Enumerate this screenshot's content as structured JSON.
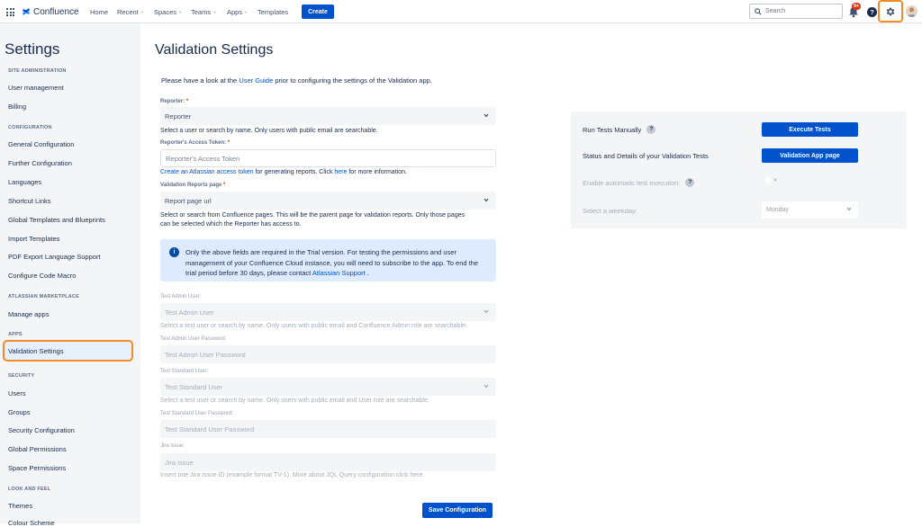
{
  "topbar": {
    "brand": "Confluence",
    "nav": [
      {
        "label": "Home",
        "caret": false
      },
      {
        "label": "Recent",
        "caret": true
      },
      {
        "label": "Spaces",
        "caret": true
      },
      {
        "label": "Teams",
        "caret": true
      },
      {
        "label": "Apps",
        "caret": true
      },
      {
        "label": "Templates",
        "caret": false
      }
    ],
    "create_label": "Create",
    "search_placeholder": "Search",
    "notification_count": "9+"
  },
  "sidebar": {
    "title": "Settings",
    "sections": [
      {
        "heading": "SITE ADMINISTRATION",
        "items": [
          "User management",
          "Billing"
        ]
      },
      {
        "heading": "CONFIGURATION",
        "items": [
          "General Configuration",
          "Further Configuration",
          "Languages",
          "Shortcut Links",
          "Global Templates and Blueprints",
          "Import Templates",
          "PDF Export Language Support",
          "Configure Code Macro"
        ]
      },
      {
        "heading": "ATLASSIAN MARKETPLACE",
        "items": [
          "Manage apps"
        ]
      },
      {
        "heading": "APPS",
        "items": [
          "Validation Settings"
        ]
      },
      {
        "heading": "SECURITY",
        "items": [
          "Users",
          "Groups",
          "Security Configuration",
          "Global Permissions",
          "Space Permissions"
        ]
      },
      {
        "heading": "LOOK AND FEEL",
        "items": [
          "Themes",
          "Colour Scheme"
        ]
      }
    ],
    "active_item": "Validation Settings"
  },
  "main": {
    "title": "Validation Settings",
    "intro_before": "Please have a look at the ",
    "intro_link": "User Guide",
    "intro_after": " prior to configuring the settings of the Validation app.",
    "reporter": {
      "label": "Reporter:",
      "required": "*",
      "value": "Reporter",
      "help": "Select a user or search by name. Only users with public email are searchable."
    },
    "token": {
      "label": "Reporter's Access Token:",
      "required": "*",
      "placeholder": "Reporter's Access Token",
      "help_link": "Create an Atlassian access token",
      "help_mid": " for generating reports. Click ",
      "help_link2": "here",
      "help_end": "  for more information."
    },
    "reports_page": {
      "label": "Validation Reports page",
      "required": "*",
      "value": "Report page url",
      "help_line1": "Select or search from Confluence pages. This will be the parent page for validation reports. Only those pages",
      "help_line2": "can be selected which the Reporter has access to."
    },
    "info": {
      "text_before": "Only the above fields are required in the Trial version. For testing the permissions and user management of your Confluence Cloud instance, you will need to subscribe to the app. To end the trial period before 30 days, please contact ",
      "link": "Atlassian Support",
      "text_after": " ."
    },
    "test_admin_user": {
      "label": "Test Admin User:",
      "placeholder": "Test Admin User",
      "help": "Select a test user or search by name. Only users with public email and Confluence Admin role are searchable."
    },
    "test_admin_password": {
      "label": "Test Admin User Password:",
      "placeholder": "Test Admin User Password"
    },
    "test_standard_user": {
      "label": "Test Standard User:",
      "placeholder": "Test Standard User",
      "help": "Select a test user or search by name. Only users with public email and User role are searchable."
    },
    "test_standard_password": {
      "label": "Test Standard User Password:",
      "placeholder": "Test Standard User Password"
    },
    "jira": {
      "label": "Jira issue:",
      "placeholder": "Jira issue",
      "help": "Insert one Jira issue ID (example format TV-1). More about JQL Query configuration click here."
    },
    "save_label": "Save Configuration"
  },
  "panel": {
    "run_label": "Run Tests Manually",
    "run_button": "Execute Tests",
    "status_label": "Status and Details of your Validation Tests",
    "status_button": "Validation App page",
    "auto_label": "Enable automatic test execution:",
    "toggle_off": "×",
    "weekday_label": "Select a weekday:",
    "weekday_value": "Monday"
  },
  "colors": {
    "primary": "#0052cc",
    "highlight": "#f08c28",
    "required": "#de350b",
    "info_bg": "#deebff"
  }
}
